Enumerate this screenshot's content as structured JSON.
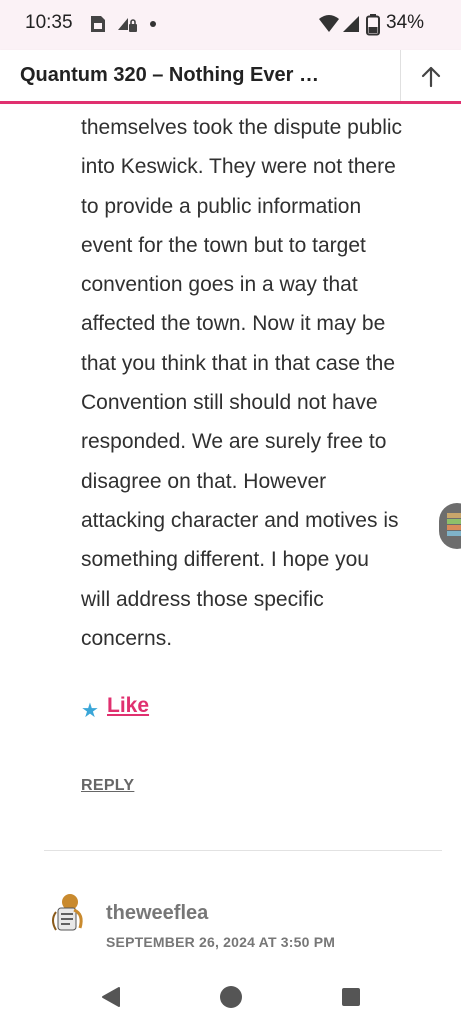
{
  "status_bar": {
    "time": "10:35",
    "battery": "34%",
    "icons": [
      "sim-card-icon",
      "vpn-lock-icon",
      "notification-dot-icon",
      "wifi-icon",
      "signal-icon",
      "battery-icon"
    ]
  },
  "header": {
    "title": "Quantum 320 – Nothing Ever …",
    "scroll_top_icon": "arrow-up-icon"
  },
  "comment": {
    "lines": [
      "themselves took the dispute public",
      "into Keswick. They were not there",
      "to provide a public information",
      "event for the town but to target",
      "convention goes in a way that",
      "affected the town. Now it may be",
      "that you think that in that case the",
      "Convention still should not have",
      "responded. We are surely free to",
      "disagree on that. However",
      "attacking character and motives is",
      "something different. I hope you",
      "will address those specific",
      "concerns."
    ],
    "like_label": "Like",
    "reply_label": "REPLY"
  },
  "next_comment": {
    "author": "theweeflea",
    "date": "SEPTEMBER 26, 2024 AT 3:50 PM"
  },
  "nav": {
    "buttons": [
      "back-icon",
      "home-icon",
      "recents-icon"
    ]
  },
  "colors": {
    "accent": "#e0306f",
    "star": "#3aa6d8",
    "status_bar_bg": "#fbf2f6"
  }
}
